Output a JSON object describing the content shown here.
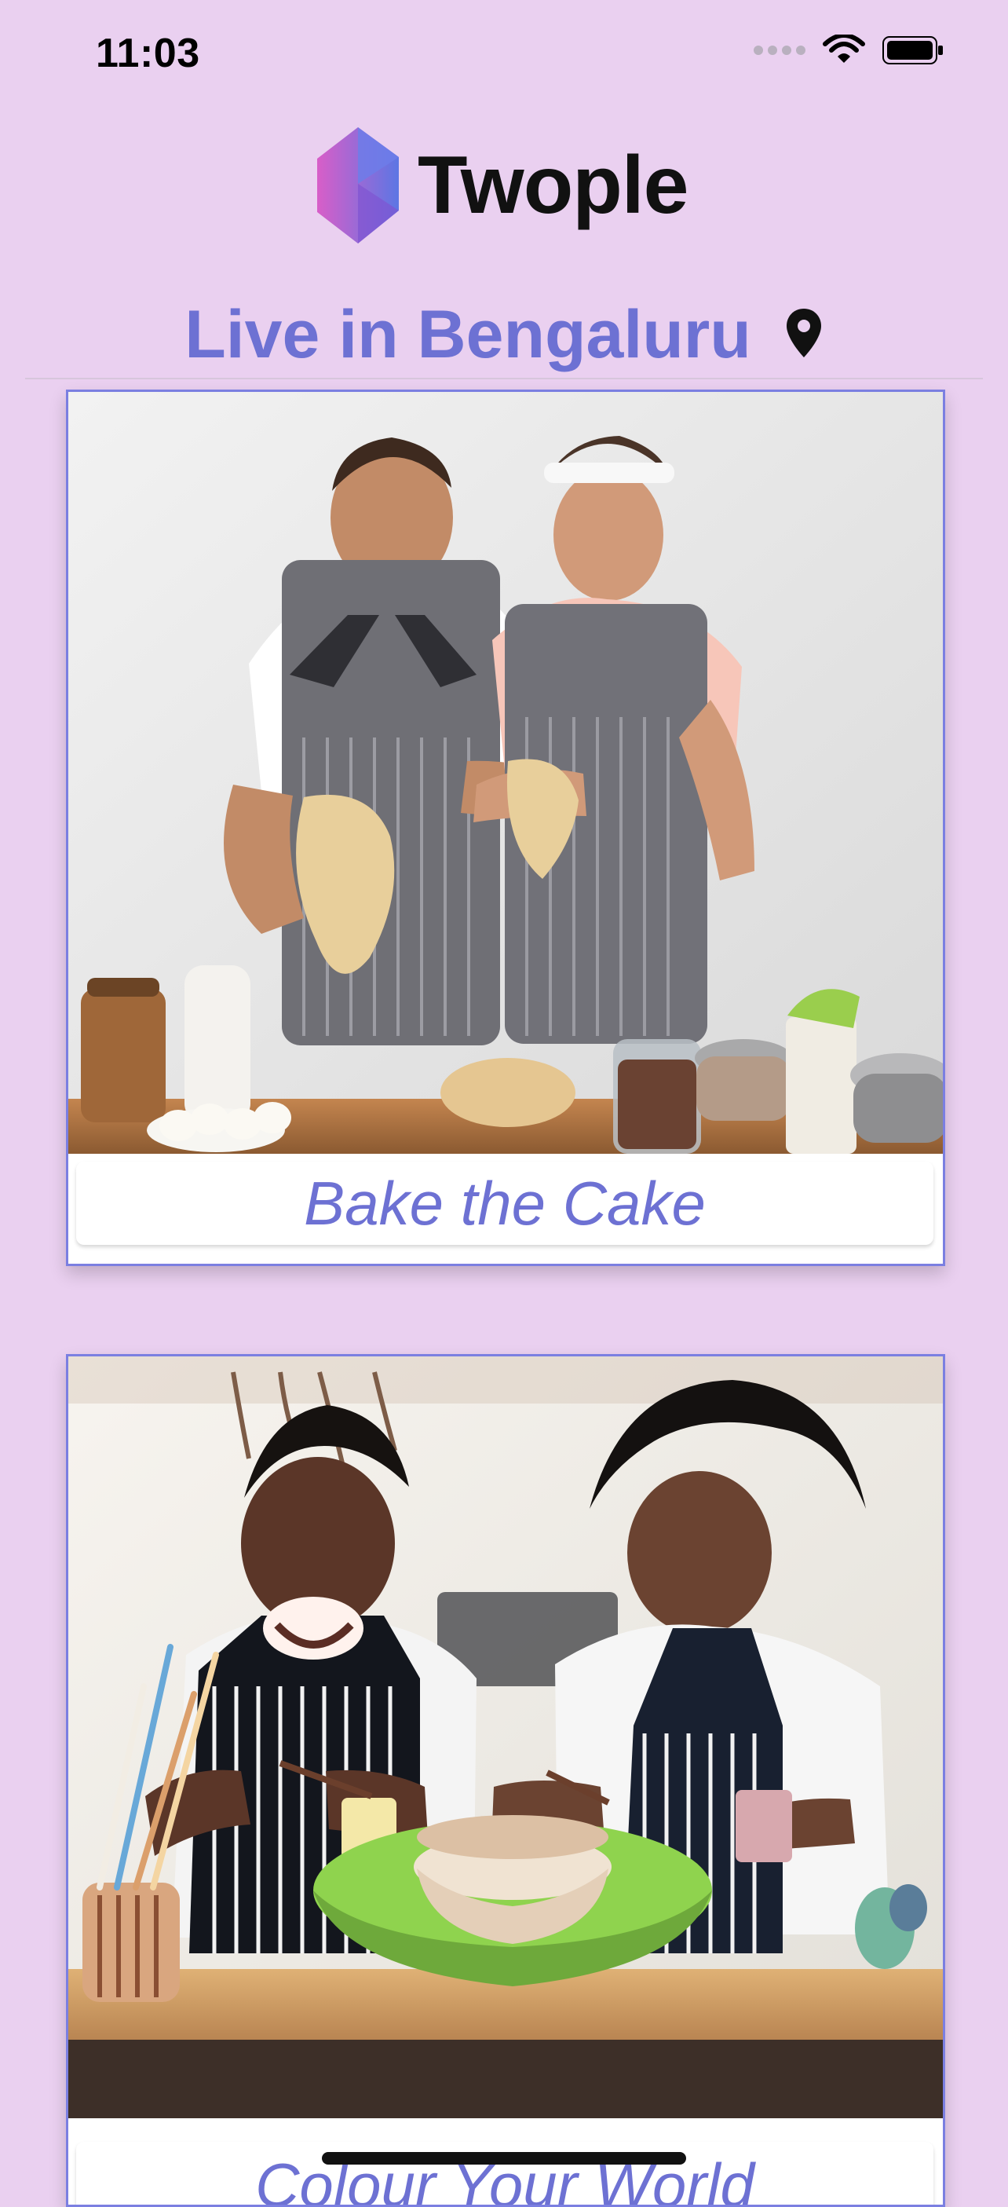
{
  "status_bar": {
    "time": "11:03",
    "icons": [
      "signal-dots",
      "wifi-icon",
      "battery-icon"
    ]
  },
  "header": {
    "brand_name": "Twople",
    "logo_icon": "twople-logo"
  },
  "location": {
    "title": "Live in Bengaluru",
    "icon": "location-pin-icon"
  },
  "cards": [
    {
      "title": "Bake the Cake",
      "image_subject": "couple kneading dough"
    },
    {
      "title": "Colour Your World",
      "image_subject": "couple painting pottery"
    }
  ],
  "colors": {
    "background": "#ead0f0",
    "accent": "#6d71d3",
    "card_border": "#7b7fe1"
  }
}
